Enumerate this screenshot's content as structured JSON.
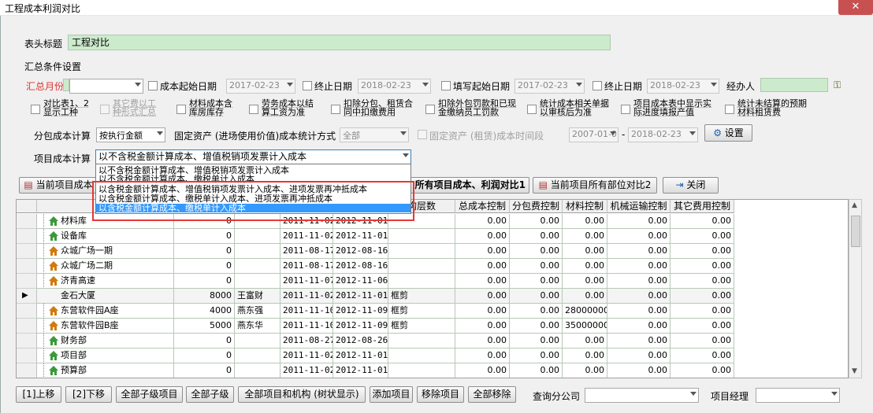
{
  "window": {
    "title": "工程成本利润对比",
    "close": "✕"
  },
  "header": {
    "title_label": "表头标题",
    "title_value": "工程对比"
  },
  "summary": {
    "section_label": "汇总条件设置",
    "month_label": "汇总月份",
    "cost_start_label": "成本起始日期",
    "cost_start_value": "2017-02-23",
    "end_label_1": "终止日期",
    "end_value_1": "2018-02-23",
    "fill_start_label": "填写起始日期",
    "fill_start_value": "2017-02-23",
    "end_label_2": "终止日期",
    "end_value_2": "2018-02-23",
    "handler_label": "经办人",
    "options": [
      "对比表1、2显示工种",
      "其它费以工种形式汇总",
      "材料成本含库房库存",
      "劳务成本以结算工资为准",
      "扣除分包、租赁合同中扣缴费用",
      "扣除外包罚款和已现金缴纳员工罚款",
      "统计成本相关单据以审核后为准",
      "项目成本表中显示实际进度填报产值",
      "统计未结算的预期材料租赁费"
    ],
    "subcontract_label": "分包成本计算",
    "subcontract_value": "按执行金额",
    "fixed_asset_label": "固定资产 (进场使用价值)成本统计方式",
    "fixed_asset_value": "全部",
    "fixed_rent_label": "固定资产 (租赁)成本时间段",
    "rent_start": "2007-01-01",
    "rent_sep": "-",
    "rent_end": "2018-02-23",
    "settings_button": "设置",
    "project_calc_label": "项目成本计算",
    "project_calc_value": "以不含税金额计算成本、增值税销项发票计入成本",
    "project_calc_options": [
      "以不含税金额计算成本、增值税销项发票计入成本",
      "以不含税金额计算成本、缴税单计入成本",
      "以含税金额计算成本、增值税销项发票计入成本、进项发票再冲抵成本",
      "以含税金额计算成本、缴税单计入成本、进项发票再冲抵成本",
      "以含税金额计算成本、缴税单计入成本"
    ]
  },
  "toolbar": {
    "btn1": "当前项目成本",
    "btn2": "所有项目成本、利润对比1",
    "btn3": "当前项目所有部位对比2",
    "close": "关闭"
  },
  "grid": {
    "headers": [
      "项目",
      "",
      "",
      "",
      "",
      "构层数",
      "总成本控制",
      "分包费控制",
      "材料控制",
      "机械运输控制",
      "其它费用控制"
    ],
    "rows": [
      {
        "name": "材料库",
        "area": "0",
        "mgr": "",
        "start": "2011-11-02",
        "end": "2012-11-01",
        "type": "",
        "v1": "0.00",
        "v2": "0.00",
        "v3": "0.00",
        "v4": "0.00",
        "v5": "0.00",
        "icon": "green"
      },
      {
        "name": "设备库",
        "area": "0",
        "mgr": "",
        "start": "2011-11-02",
        "end": "2012-11-01",
        "type": "",
        "v1": "0.00",
        "v2": "0.00",
        "v3": "0.00",
        "v4": "0.00",
        "v5": "0.00",
        "icon": "green"
      },
      {
        "name": "众城广场一期",
        "area": "0",
        "mgr": "",
        "start": "2011-08-17",
        "end": "2012-08-16",
        "type": "",
        "v1": "0.00",
        "v2": "0.00",
        "v3": "0.00",
        "v4": "0.00",
        "v5": "0.00",
        "icon": "orange"
      },
      {
        "name": "众城广场二期",
        "area": "0",
        "mgr": "",
        "start": "2011-08-17",
        "end": "2012-08-16",
        "type": "",
        "v1": "0.00",
        "v2": "0.00",
        "v3": "0.00",
        "v4": "0.00",
        "v5": "0.00",
        "icon": "orange"
      },
      {
        "name": "济青高速",
        "area": "0",
        "mgr": "",
        "start": "2011-11-07",
        "end": "2012-11-06",
        "type": "",
        "v1": "0.00",
        "v2": "0.00",
        "v3": "0.00",
        "v4": "0.00",
        "v5": "0.00",
        "icon": "orange"
      },
      {
        "name": "金石大厦",
        "area": "8000",
        "mgr": "王富财",
        "start": "2011-11-02",
        "end": "2012-11-01",
        "type": "框剪",
        "v1": "0.00",
        "v2": "0.00",
        "v3": "0.00",
        "v4": "0.00",
        "v5": "0.00",
        "icon": "orange"
      },
      {
        "name": "东营软件园A座",
        "area": "4000",
        "mgr": "燕东强",
        "start": "2011-11-10",
        "end": "2012-11-09",
        "type": "框剪",
        "v1": "0.00",
        "v2": "0.00",
        "v3": "28000000.",
        "v4": "0.00",
        "v5": "0.00",
        "icon": "orange"
      },
      {
        "name": "东营软件园B座",
        "area": "5000",
        "mgr": "燕东华",
        "start": "2011-11-10",
        "end": "2012-11-09",
        "type": "框剪",
        "v1": "0.00",
        "v2": "0.00",
        "v3": "35000000.",
        "v4": "0.00",
        "v5": "0.00",
        "icon": "orange"
      },
      {
        "name": "财务部",
        "area": "0",
        "mgr": "",
        "start": "2011-08-27",
        "end": "2012-08-26",
        "type": "",
        "v1": "0.00",
        "v2": "0.00",
        "v3": "0.00",
        "v4": "0.00",
        "v5": "0.00",
        "icon": "green"
      },
      {
        "name": "项目部",
        "area": "0",
        "mgr": "",
        "start": "2011-11-02",
        "end": "2012-11-01",
        "type": "",
        "v1": "0.00",
        "v2": "0.00",
        "v3": "0.00",
        "v4": "0.00",
        "v5": "0.00",
        "icon": "green"
      },
      {
        "name": "预算部",
        "area": "0",
        "mgr": "",
        "start": "2011-11-02",
        "end": "2012-11-01",
        "type": "",
        "v1": "0.00",
        "v2": "0.00",
        "v3": "0.00",
        "v4": "0.00",
        "v5": "0.00",
        "icon": "green"
      }
    ]
  },
  "bottom": {
    "up": "[1]上移",
    "down": "[2]下移",
    "all_child": "全部子级项目",
    "all_sub": "全部子级",
    "all_tree": "全部项目和机构 (树状显示)",
    "add": "添加项目",
    "remove": "移除项目",
    "remove_all": "全部移除",
    "company_label": "查询分公司",
    "pm_label": "项目经理"
  }
}
